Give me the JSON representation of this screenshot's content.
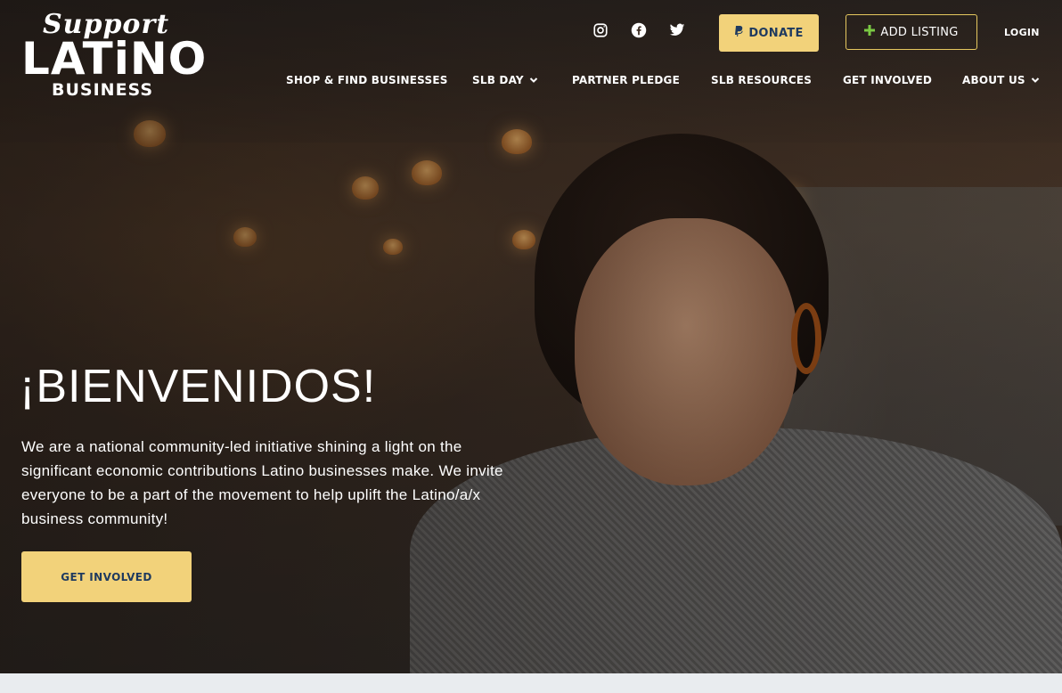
{
  "logo": {
    "line1": "Support",
    "line2": "LATiNO",
    "line3": "BUSINESS"
  },
  "header": {
    "social_icons": [
      "instagram-icon",
      "facebook-icon",
      "twitter-icon"
    ],
    "donate_label": "DONATE",
    "add_listing_label": "ADD LISTING",
    "login_label": "LOGIN"
  },
  "nav": {
    "items": [
      {
        "label": "SHOP & FIND BUSINESSES",
        "has_dropdown": false
      },
      {
        "label": "SLB DAY",
        "has_dropdown": true
      },
      {
        "label": "PARTNER PLEDGE",
        "has_dropdown": false
      },
      {
        "label": "SLB RESOURCES",
        "has_dropdown": false
      },
      {
        "label": "GET INVOLVED",
        "has_dropdown": false
      },
      {
        "label": "ABOUT US",
        "has_dropdown": true
      }
    ]
  },
  "hero": {
    "headline": "¡BIENVENIDOS!",
    "paragraph": "We are a national community-led initiative shining a light on the significant economic contributions Latino businesses make. We invite everyone to be a part of the movement to help uplift the Latino/a/x business community!",
    "cta_label": "GET INVOLVED"
  },
  "colors": {
    "accent_yellow": "#f2d27a",
    "navy": "#1f3a5f",
    "add_listing_icon": "#7ac943"
  }
}
